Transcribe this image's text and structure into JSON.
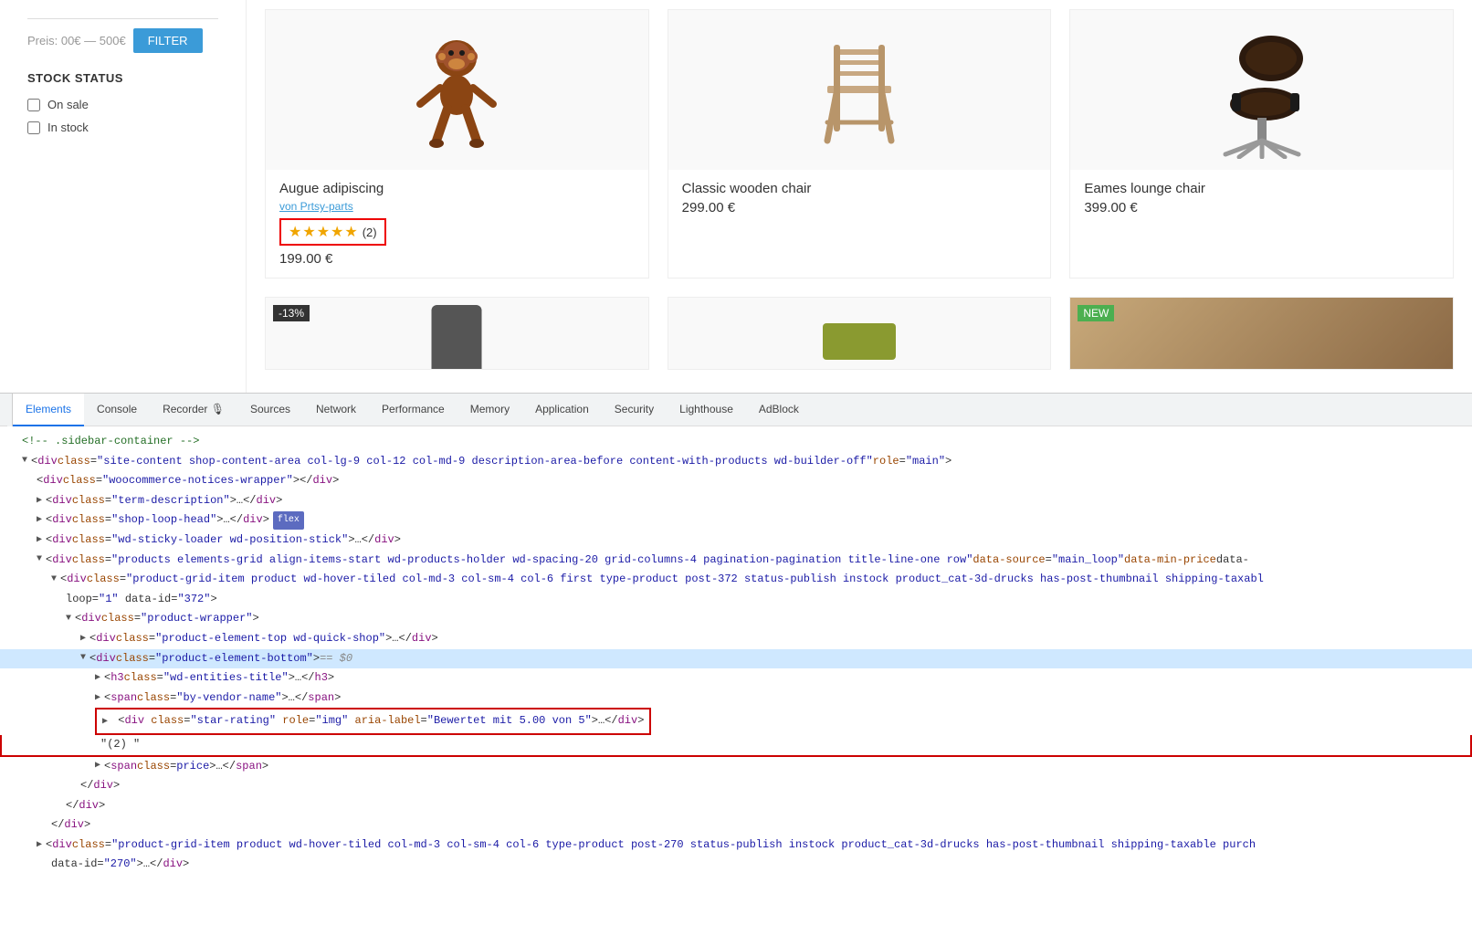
{
  "sidebar": {
    "price_label": "Preis: 00€ — 500€",
    "filter_btn": "FILTER",
    "stock_status_title": "STOCK STATUS",
    "checkboxes": [
      {
        "label": "On sale",
        "checked": false
      },
      {
        "label": "In stock",
        "checked": false
      }
    ]
  },
  "products": {
    "row1": [
      {
        "id": "p1",
        "title": "Augue adipiscing",
        "vendor": "von Prtsy-parts",
        "stars": "★★★★★",
        "reviews": "(2)",
        "price": "199.00 €",
        "has_rating_highlight": true
      },
      {
        "id": "p2",
        "title": "Classic wooden chair",
        "vendor": "",
        "price": "299.00 €",
        "has_rating_highlight": false
      },
      {
        "id": "p3",
        "title": "Eames lounge chair",
        "vendor": "",
        "price": "399.00 €",
        "has_rating_highlight": false
      }
    ],
    "row2": [
      {
        "id": "p4",
        "badge": "-13%",
        "badge_type": "discount"
      },
      {
        "id": "p5",
        "badge": "",
        "badge_type": ""
      },
      {
        "id": "p6",
        "badge": "NEW",
        "badge_type": "new"
      }
    ]
  },
  "devtools": {
    "tabs": [
      {
        "id": "elements",
        "label": "Elements",
        "active": true
      },
      {
        "id": "console",
        "label": "Console",
        "active": false
      },
      {
        "id": "recorder",
        "label": "Recorder 🎙",
        "active": false
      },
      {
        "id": "sources",
        "label": "Sources",
        "active": false
      },
      {
        "id": "network",
        "label": "Network",
        "active": false
      },
      {
        "id": "performance",
        "label": "Performance",
        "active": false
      },
      {
        "id": "memory",
        "label": "Memory",
        "active": false
      },
      {
        "id": "application",
        "label": "Application",
        "active": false
      },
      {
        "id": "security",
        "label": "Security",
        "active": false
      },
      {
        "id": "lighthouse",
        "label": "Lighthouse",
        "active": false
      },
      {
        "id": "adblock",
        "label": "AdBlock",
        "active": false
      }
    ],
    "code_lines": [
      {
        "id": "l1",
        "indent": 1,
        "content": "<!-- .sidebar-container -->",
        "type": "comment",
        "selected": false,
        "highlighted": false,
        "has_toggle": false
      },
      {
        "id": "l2",
        "indent": 1,
        "content": "<div class=\"site-content shop-content-area col-lg-9 col-12 col-md-9 description-area-before content-with-products wd-builder-off\" role=\"main\">",
        "type": "open",
        "selected": false,
        "highlighted": false,
        "has_toggle": true,
        "expanded": true
      },
      {
        "id": "l3",
        "indent": 2,
        "content": "<div class=\"woocommerce-notices-wrapper\"></div>",
        "type": "self",
        "selected": false,
        "highlighted": false,
        "has_toggle": false
      },
      {
        "id": "l4",
        "indent": 2,
        "content": "<div class=\"term-description\">…</div>",
        "type": "collapsed",
        "selected": false,
        "highlighted": false,
        "has_toggle": true
      },
      {
        "id": "l5",
        "indent": 2,
        "content": "<div class=\"shop-loop-head\">…</div>",
        "type": "collapsed",
        "selected": false,
        "highlighted": false,
        "has_toggle": true,
        "has_flex": true
      },
      {
        "id": "l6",
        "indent": 2,
        "content": "<div class=\"wd-sticky-loader wd-position-stick\">…</div>",
        "type": "collapsed",
        "selected": false,
        "highlighted": false,
        "has_toggle": true
      },
      {
        "id": "l7",
        "indent": 2,
        "content": "<div class=\"products elements-grid align-items-start wd-products-holder  wd-spacing-20 grid-columns-4 pagination-pagination title-line-one row\" data-source=\"main_loop\" data-min-price data-",
        "type": "open",
        "selected": false,
        "highlighted": false,
        "has_toggle": true,
        "expanded": true
      },
      {
        "id": "l8",
        "indent": 3,
        "content": "<div class=\"product-grid-item product wd-hover-tiled  col-md-3 col-sm-4 col-6 first  type-product post-372 status-publish instock product_cat-3d-drucks has-post-thumbnail shipping-taxabl",
        "type": "open",
        "selected": false,
        "highlighted": false,
        "has_toggle": true,
        "expanded": true
      },
      {
        "id": "l9",
        "indent": 4,
        "content": "loop=\"1\" data-id=\"372\">",
        "type": "text",
        "selected": false,
        "highlighted": false,
        "has_toggle": false
      },
      {
        "id": "l10",
        "indent": 4,
        "content": "<div class=\"product-wrapper\">",
        "type": "open",
        "selected": false,
        "highlighted": false,
        "has_toggle": true,
        "expanded": true
      },
      {
        "id": "l11",
        "indent": 5,
        "content": "<div class=\"product-element-top wd-quick-shop\">…</div>",
        "type": "collapsed",
        "selected": false,
        "highlighted": false,
        "has_toggle": true
      },
      {
        "id": "l12",
        "indent": 5,
        "content": "<div class=\"product-element-bottom\"> == $0",
        "type": "selected",
        "selected": true,
        "highlighted": false,
        "has_toggle": true,
        "expanded": true
      },
      {
        "id": "l13",
        "indent": 6,
        "content": "<h3 class=\"wd-entities-title\">…</h3>",
        "type": "collapsed",
        "selected": false,
        "highlighted": false,
        "has_toggle": true
      },
      {
        "id": "l14",
        "indent": 6,
        "content": "<span class=\"by-vendor-name\">…</span>",
        "type": "collapsed",
        "selected": false,
        "highlighted": false,
        "has_toggle": true
      },
      {
        "id": "l15",
        "indent": 6,
        "content": "<div class=\"star-rating\" role=\"img\" aria-label=\"Bewertet mit 5.00 von 5\">…</div>",
        "type": "red-highlight",
        "selected": false,
        "highlighted": true,
        "has_toggle": true
      },
      {
        "id": "l16",
        "indent": 6,
        "content": "\"(2) \"",
        "type": "text-content",
        "selected": false,
        "highlighted": true,
        "has_toggle": false
      },
      {
        "id": "l17",
        "indent": 6,
        "content": "<span class= price >…</span>",
        "type": "collapsed",
        "selected": false,
        "highlighted": false,
        "has_toggle": true
      },
      {
        "id": "l18",
        "indent": 5,
        "content": "</div>",
        "type": "close",
        "selected": false,
        "highlighted": false,
        "has_toggle": false
      },
      {
        "id": "l19",
        "indent": 4,
        "content": "</div>",
        "type": "close",
        "selected": false,
        "highlighted": false,
        "has_toggle": false
      },
      {
        "id": "l20",
        "indent": 3,
        "content": "</div>",
        "type": "close",
        "selected": false,
        "highlighted": false,
        "has_toggle": false
      },
      {
        "id": "l21",
        "indent": 2,
        "content": "<div class=\"product-grid-item product wd-hover-tiled  col-md-3 col-sm-4 col-6 type-product post-270 status-publish instock product_cat-3d-drucks has-post-thumbnail shipping-taxable purch",
        "type": "collapsed2",
        "selected": false,
        "highlighted": false,
        "has_toggle": true
      },
      {
        "id": "l22",
        "indent": 3,
        "content": "data-id=\"270\">…</div>",
        "type": "text",
        "selected": false,
        "highlighted": false,
        "has_toggle": false
      }
    ]
  }
}
